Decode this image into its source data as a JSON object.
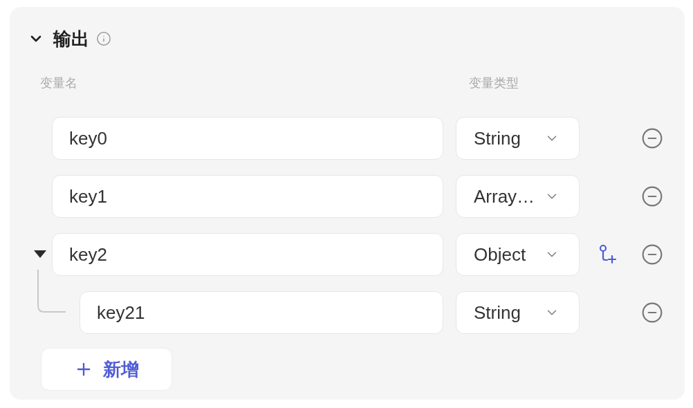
{
  "section": {
    "title": "输出",
    "expanded": true
  },
  "columns": [
    "变量名",
    "变量类型"
  ],
  "fields": [
    {
      "name": "key0",
      "type": "String",
      "addable": false
    },
    {
      "name": "key1",
      "type": "Array…",
      "addable": false
    },
    {
      "name": "key2",
      "type": "Object",
      "addable": true,
      "expanded": true,
      "children": [
        {
          "name": "key21",
          "type": "String",
          "addable": false
        }
      ]
    }
  ],
  "add_button": "新增"
}
